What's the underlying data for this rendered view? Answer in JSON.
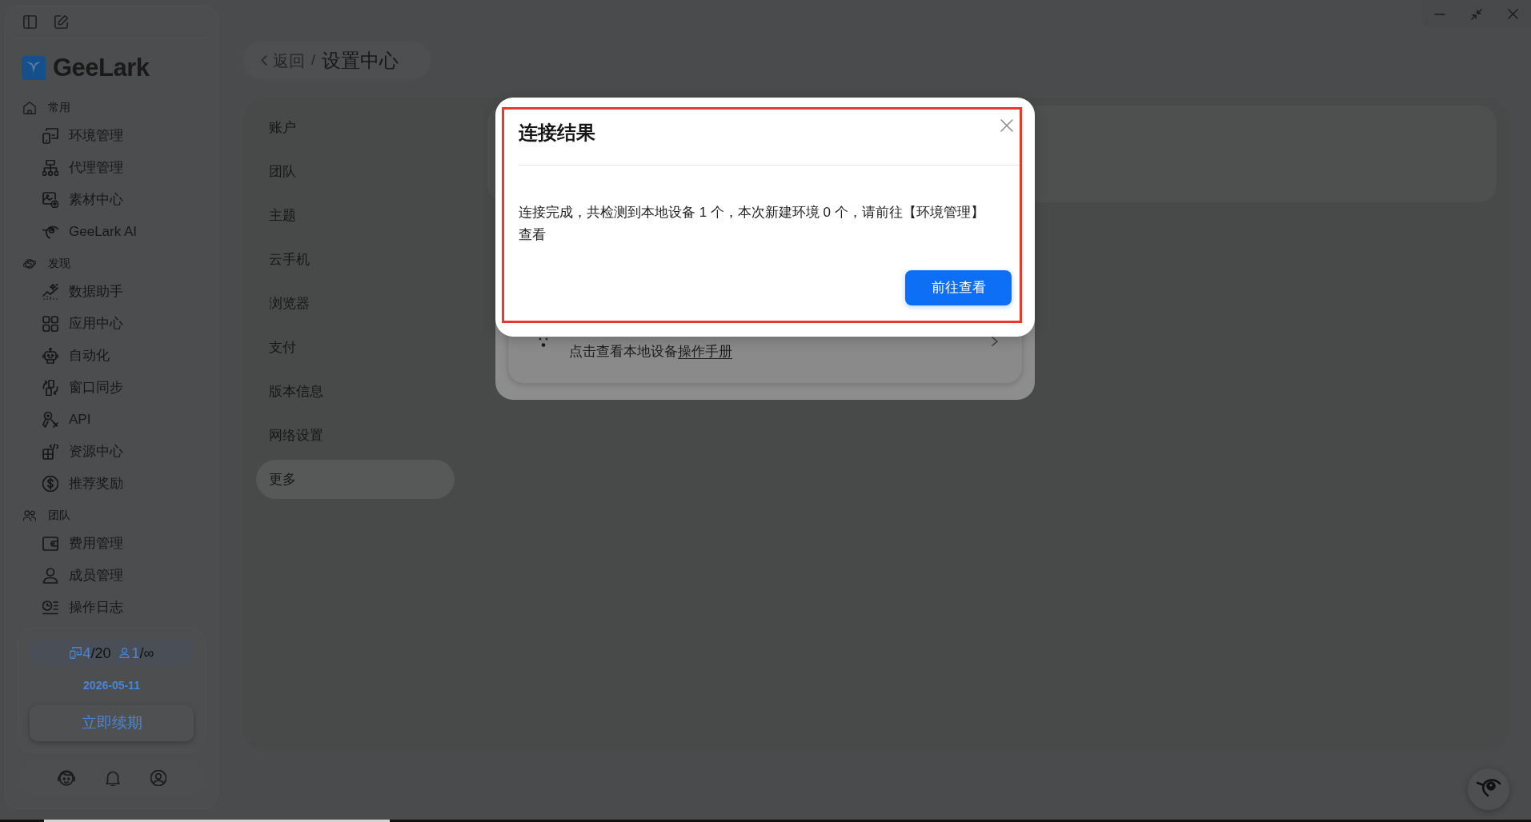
{
  "sidebar": {
    "brand": "GeeLark",
    "sections": [
      {
        "title": "常用",
        "items": [
          {
            "label": "环境管理"
          },
          {
            "label": "代理管理"
          },
          {
            "label": "素材中心"
          },
          {
            "label": "GeeLark AI"
          }
        ]
      },
      {
        "title": "发现",
        "items": [
          {
            "label": "数据助手"
          },
          {
            "label": "应用中心"
          },
          {
            "label": "自动化"
          },
          {
            "label": "窗口同步"
          },
          {
            "label": "API"
          },
          {
            "label": "资源中心"
          },
          {
            "label": "推荐奖励"
          }
        ]
      },
      {
        "title": "团队",
        "items": [
          {
            "label": "费用管理"
          },
          {
            "label": "成员管理"
          },
          {
            "label": "操作日志"
          }
        ]
      }
    ],
    "plan": {
      "devices_used": "4",
      "devices_limit": "/20",
      "members_used": "1",
      "members_limit": "/∞",
      "expiry_date": "2026-05-11",
      "renew_button": "立即续期"
    }
  },
  "breadcrumb": {
    "back": "返回",
    "separator": "/",
    "current": "设置中心"
  },
  "settings_nav": [
    {
      "label": "账户",
      "selected": false
    },
    {
      "label": "团队",
      "selected": false
    },
    {
      "label": "主题",
      "selected": false
    },
    {
      "label": "云手机",
      "selected": false
    },
    {
      "label": "浏览器",
      "selected": false
    },
    {
      "label": "支付",
      "selected": false
    },
    {
      "label": "版本信息",
      "selected": false
    },
    {
      "label": "网络设置",
      "selected": false
    },
    {
      "label": "更多",
      "selected": true
    }
  ],
  "background_dialog": {
    "hint": "点击查看本地设备",
    "link": "操作手册"
  },
  "dialog": {
    "title": "连接结果",
    "message": "连接完成，共检测到本地设备 1 个，本次新建环境 0 个，请前往【环境管理】查看",
    "button": "前往查看"
  }
}
